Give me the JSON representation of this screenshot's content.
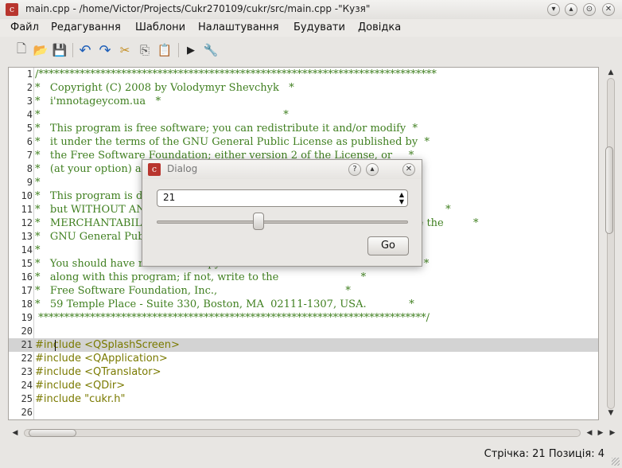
{
  "window": {
    "title": "main.cpp - /home/Victor/Projects/Cukr270109/cukr/src/main.cpp -\"Кузя\"",
    "icon": "c-app-icon",
    "controls": {
      "menu": "▾",
      "minimize": "▴",
      "maximize": "⊙",
      "close": "✕"
    }
  },
  "menu": {
    "items": [
      "Файл",
      "Редагування",
      "Шаблони",
      "Налаштування",
      "Будувати",
      "Довідка"
    ]
  },
  "toolbar": {
    "buttons": [
      "new-file-icon",
      "open-folder-icon",
      "save-icon",
      "undo-icon",
      "redo-icon",
      "cut-icon",
      "copy-icon",
      "paste-icon",
      "run-icon",
      "build-tools-icon"
    ],
    "glyphs": {
      "new": "🗋",
      "open": "📂",
      "save": "💾",
      "undo": "↶",
      "redo": "↷",
      "cut": "✂",
      "copy": "⎘",
      "paste": "📋",
      "run": "▶",
      "tools": "🔧"
    }
  },
  "editor": {
    "current_line": 21,
    "lines": [
      {
        "n": "1",
        "text": "/*****************************************************************************",
        "kind": "comment"
      },
      {
        "n": "2",
        "text": "*   Copyright (C) 2008 by Volodymyr Shevchyk   *",
        "kind": "comment"
      },
      {
        "n": "3",
        "text": "*   i'mnotageycom.ua   *",
        "kind": "comment"
      },
      {
        "n": "4",
        "text": "*                                                                          *",
        "kind": "comment"
      },
      {
        "n": "5",
        "text": "*   This program is free software; you can redistribute it and/or modify  *",
        "kind": "comment"
      },
      {
        "n": "6",
        "text": "*   it under the terms of the GNU General Public License as published by  *",
        "kind": "comment"
      },
      {
        "n": "7",
        "text": "*   the Free Software Foundation; either version 2 of the License, or     *",
        "kind": "comment"
      },
      {
        "n": "8",
        "text": "*   (at your option) any later version.                                   *",
        "kind": "comment"
      },
      {
        "n": "9",
        "text": "*",
        "kind": "comment"
      },
      {
        "n": "10",
        "text": "*   This program is distributed in the hope that it will be useful,       *",
        "kind": "comment"
      },
      {
        "n": "11",
        "text": "*   but WITHOUT ANY WARRANTY; without even the implied warranty of        *",
        "kind": "comment"
      },
      {
        "n": "12",
        "text": "*   MERCHANTABILITY or FITNESS FOR A PARTICULAR PURPOSE.  See the         *",
        "kind": "comment"
      },
      {
        "n": "13",
        "text": "*   GNU General Public License for more details.",
        "kind": "comment"
      },
      {
        "n": "14",
        "text": "*",
        "kind": "comment"
      },
      {
        "n": "15",
        "text": "*   You should have received a copy of the GNU General Public License     *",
        "kind": "comment"
      },
      {
        "n": "16",
        "text": "*   along with this program; if not, write to the                         *",
        "kind": "comment"
      },
      {
        "n": "17",
        "text": "*   Free Software Foundation, Inc.,                                       *",
        "kind": "comment"
      },
      {
        "n": "18",
        "text": "*   59 Temple Place - Suite 330, Boston, MA  02111-1307, USA.             *",
        "kind": "comment"
      },
      {
        "n": "19",
        "text": " ***************************************************************************/",
        "kind": "comment"
      },
      {
        "n": "20",
        "text": "",
        "kind": "plain"
      },
      {
        "n": "21",
        "text": "#include <QSplashScreen>",
        "kind": "preproc"
      },
      {
        "n": "22",
        "text": "#include <QApplication>",
        "kind": "preproc"
      },
      {
        "n": "23",
        "text": "#include <QTranslator>",
        "kind": "preproc"
      },
      {
        "n": "24",
        "text": "#include <QDir>",
        "kind": "preproc"
      },
      {
        "n": "25",
        "text": "#include \"cukr.h\"",
        "kind": "preproc"
      },
      {
        "n": "26",
        "text": "",
        "kind": "plain"
      }
    ]
  },
  "scrollbars": {
    "up": "▲",
    "down": "▼",
    "left": "◀",
    "right": "▶"
  },
  "status": {
    "text": "Стрічка: 21 Позиція: 4"
  },
  "dialog": {
    "title": "Dialog",
    "controls": {
      "help": "?",
      "maximize": "▴",
      "close": "✕"
    },
    "spin_value": "21",
    "spin_arrows": "▲▼",
    "slider_fraction": 0.4,
    "go_label": "Go"
  }
}
